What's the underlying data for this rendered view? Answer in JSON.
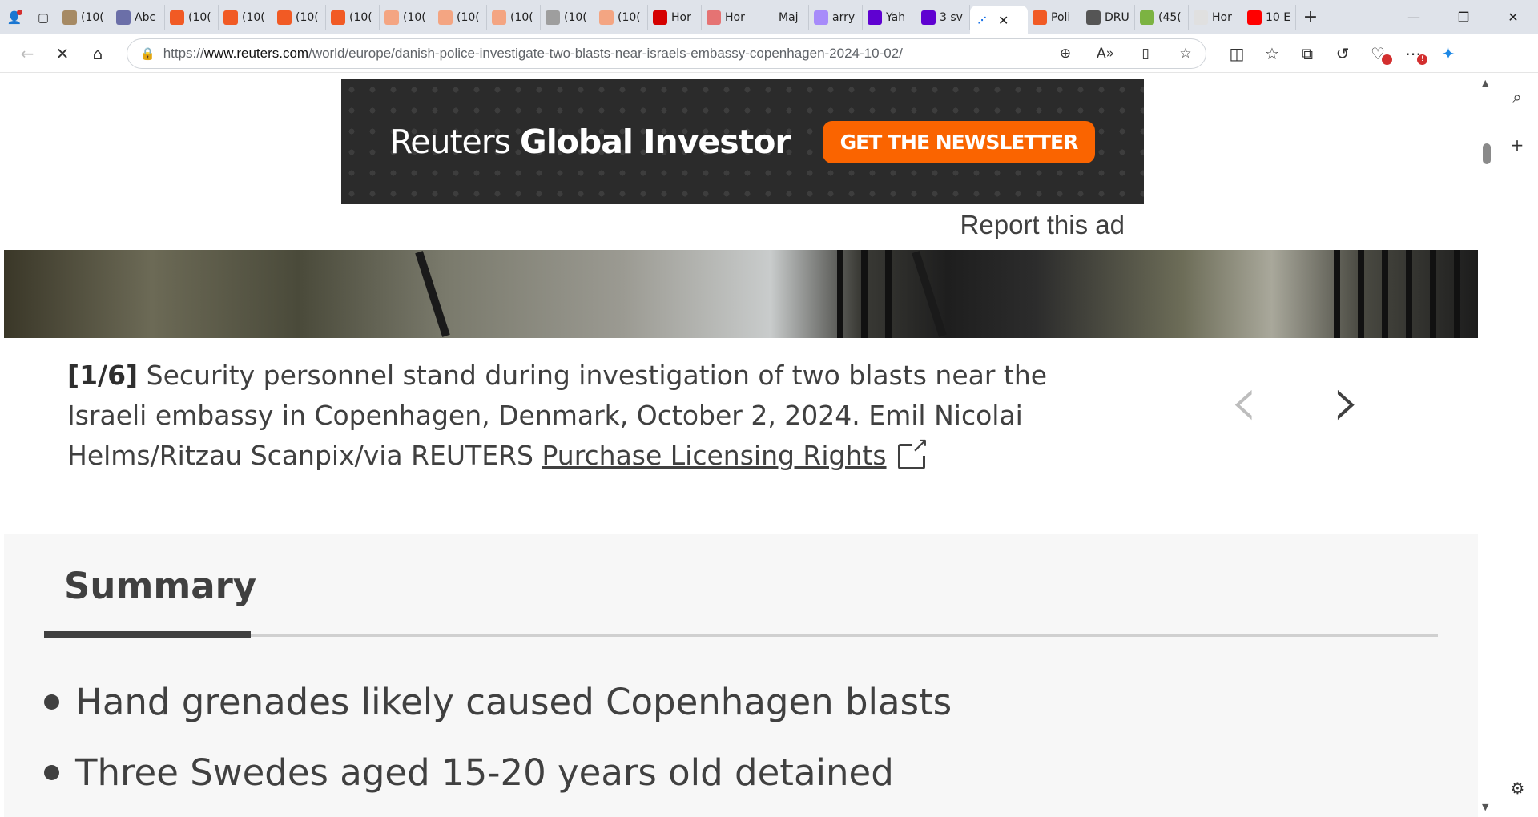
{
  "browser": {
    "tabs": [
      {
        "title": "(10(",
        "icon": "photo-icon",
        "color": "#a68a64"
      },
      {
        "title": "Abc",
        "icon": "va-icon",
        "color": "#6b6fa8"
      },
      {
        "title": "(10(",
        "icon": "bookmark-icon",
        "color": "#f15a24"
      },
      {
        "title": "(10(",
        "icon": "bookmark-icon",
        "color": "#f15a24"
      },
      {
        "title": "(10(",
        "icon": "bookmark-icon",
        "color": "#f15a24"
      },
      {
        "title": "(10(",
        "icon": "bookmark-icon",
        "color": "#f15a24"
      },
      {
        "title": "(10(",
        "icon": "bookmark-icon",
        "color": "#f4a582"
      },
      {
        "title": "(10(",
        "icon": "bookmark-icon",
        "color": "#f4a582"
      },
      {
        "title": "(10(",
        "icon": "bookmark-icon",
        "color": "#f4a582"
      },
      {
        "title": "(10(",
        "icon": "profile-icon",
        "color": "#9e9e9e"
      },
      {
        "title": "(10(",
        "icon": "bookmark-icon",
        "color": "#f4a582"
      },
      {
        "title": "Hor",
        "icon": "alert-icon",
        "color": "#d50000"
      },
      {
        "title": "Hor",
        "icon": "alert-icon",
        "color": "#e57373"
      },
      {
        "title": "Maj",
        "icon": "search-icon",
        "color": "#dfe3ea"
      },
      {
        "title": "arry",
        "icon": "yahoo-icon",
        "color": "#a78bfa"
      },
      {
        "title": "Yah",
        "icon": "yahoo-icon",
        "color": "#5f01d1"
      },
      {
        "title": "3 sv",
        "icon": "yahoo-icon",
        "color": "#5f01d1"
      }
    ],
    "active_tab_icon": "loading-icon",
    "tabs_after": [
      {
        "title": "Poli",
        "icon": "b-icon",
        "color": "#f15a24"
      },
      {
        "title": "DRU",
        "icon": "dr-icon",
        "color": "#555555"
      },
      {
        "title": "(45(",
        "icon": "g-icon",
        "color": "#7cb342"
      },
      {
        "title": "Hor",
        "icon": "bird-icon",
        "color": "#e0e0e0"
      },
      {
        "title": "10 E",
        "icon": "youtube-icon",
        "color": "#ff0000"
      }
    ],
    "url_prefix": "https://",
    "url_host": "www.reuters.com",
    "url_path": "/world/europe/danish-police-investigate-two-blasts-near-israels-embassy-copenhagen-2024-10-02/"
  },
  "ad": {
    "brand_light": "Reuters",
    "brand_bold": "Global Investor",
    "button": "GET THE NEWSLETTER",
    "report": "Report this ad"
  },
  "caption": {
    "counter": "[1/6]",
    "text": "Security personnel stand during investigation of two blasts near the Israeli embassy in Copenhagen, Denmark, October 2, 2024. Emil Nicolai Helms/Ritzau Scanpix/via REUTERS",
    "link": "Purchase Licensing Rights"
  },
  "summary": {
    "heading": "Summary",
    "bullets": [
      "Hand grenades likely caused Copenhagen blasts",
      "Three Swedes aged 15-20 years old detained"
    ]
  }
}
